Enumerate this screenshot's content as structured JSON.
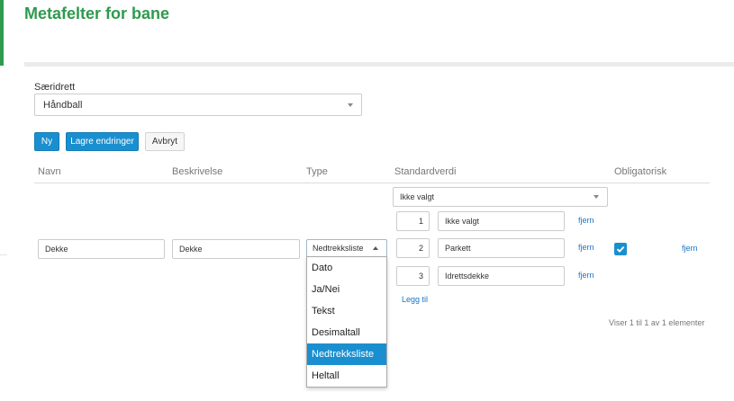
{
  "page": {
    "title": "Metafelter for bane"
  },
  "sport": {
    "label": "Særidrett",
    "selected": "Håndball"
  },
  "toolbar": {
    "new_label": "Ny",
    "save_label": "Lagre endringer",
    "cancel_label": "Avbryt"
  },
  "table": {
    "columns": [
      "Navn",
      "Beskrivelse",
      "Type",
      "Standardverdi",
      "Obligatorisk"
    ],
    "row": {
      "name": "Dekke",
      "description": "Dekke",
      "type": "Nedtrekksliste",
      "default_value": "Ikke valgt",
      "options": [
        {
          "order": "1",
          "value": "Ikke valgt",
          "remove_label": "fjern"
        },
        {
          "order": "2",
          "value": "Parkett",
          "remove_label": "fjern"
        },
        {
          "order": "3",
          "value": "Idrettsdekke",
          "remove_label": "fjern"
        }
      ],
      "add_label": "Legg til",
      "required": true,
      "remove_label": "fjern"
    },
    "type_options": [
      "Dato",
      "Ja/Nei",
      "Tekst",
      "Desimaltall",
      "Nedtrekksliste",
      "Heltall"
    ],
    "selected_type_index": 4
  },
  "pager": {
    "info": "Viser 1 til 1 av 1 elementer"
  },
  "colors": {
    "accent_green": "#2e9a4e",
    "primary_blue": "#1a8fd0",
    "link_blue": "#1a73c8"
  }
}
